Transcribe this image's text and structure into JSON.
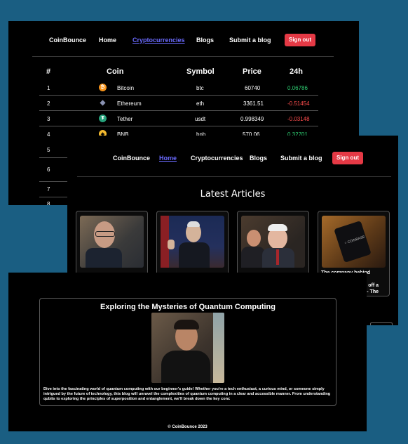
{
  "nav": {
    "brand": "CoinBounce",
    "home": "Home",
    "cryptocurrencies": "Cryptocurrencies",
    "blogs": "Blogs",
    "submit": "Submit a blog",
    "signout": "Sign out"
  },
  "crypto_table": {
    "headers": {
      "rank": "#",
      "coin": "Coin",
      "symbol": "Symbol",
      "price": "Price",
      "change": "24h"
    },
    "rows": [
      {
        "rank": "1",
        "name": "Bitcoin",
        "symbol": "btc",
        "price": "60740",
        "change": "0.06786",
        "icon": "bitcoin-icon",
        "icon_color": "#f7931a"
      },
      {
        "rank": "2",
        "name": "Ethereum",
        "symbol": "eth",
        "price": "3361.51",
        "change": "-0.51454",
        "icon": "ethereum-icon",
        "icon_color": "#8a92b2"
      },
      {
        "rank": "3",
        "name": "Tether",
        "symbol": "usdt",
        "price": "0.998349",
        "change": "-0.03148",
        "icon": "tether-icon",
        "icon_color": "#26a17b"
      },
      {
        "rank": "4",
        "name": "BNB",
        "symbol": "bnb",
        "price": "570.06",
        "change": "0.32701",
        "icon": "bnb-icon",
        "icon_color": "#f3ba2f"
      }
    ],
    "more_ranks": [
      "5",
      "6",
      "7",
      "8"
    ]
  },
  "articles": {
    "heading": "Latest Articles",
    "cards": [
      {
        "caption": ""
      },
      {
        "caption": ""
      },
      {
        "caption": ""
      },
      {
        "caption": "The company behind celebrity",
        "caption2": "off a",
        "caption3": "- The"
      }
    ]
  },
  "blog": {
    "title": "Exploring the Mysteries of Quantum Computing",
    "body": "Dive into the fascinating world of quantum computing with our beginner's guide! Whether you're a tech enthusiast, a curious mind, or someone simply intrigued by the future of technology, this blog will unravel the complexities of quantum computing in a clear and accessible manner. From understanding qubits to exploring the principles of superposition and entanglement, we'll break down the key conc"
  },
  "footer": {
    "copyright": "© CoinBounce 2023"
  },
  "colors": {
    "accent_red": "#e53945",
    "link_blue": "#6b6bff",
    "positive": "#2ecc71",
    "negative": "#ff4d4d",
    "backdrop": "#1a5e82"
  }
}
